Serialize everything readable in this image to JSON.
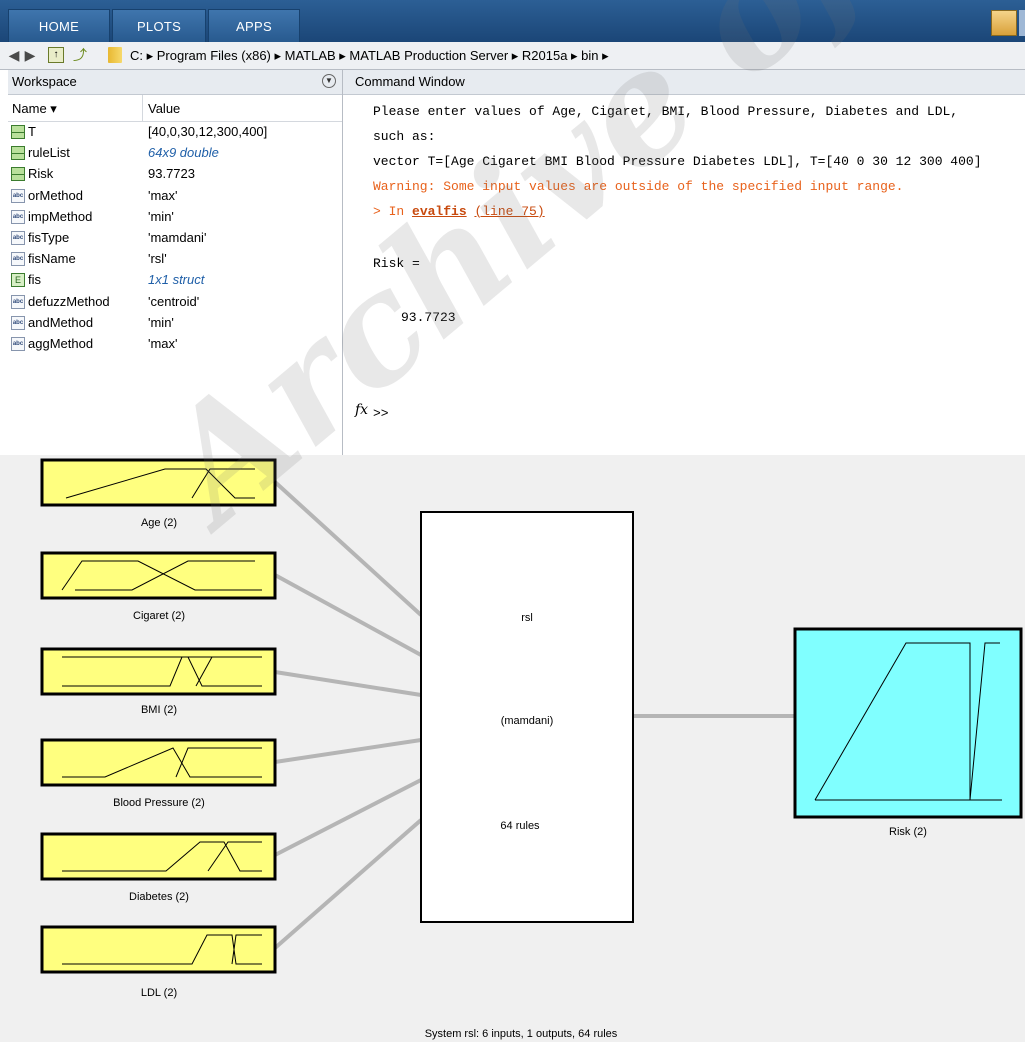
{
  "toolstrip": {
    "tabs": [
      "HOME",
      "PLOTS",
      "APPS"
    ]
  },
  "address": {
    "path": "C: ▸ Program Files (x86) ▸ MATLAB ▸ MATLAB Production Server ▸ R2015a ▸ bin ▸"
  },
  "workspace": {
    "title": "Workspace",
    "col_name": "Name ▾",
    "col_value": "Value",
    "rows": [
      {
        "name": "T",
        "value": "[40,0,30,12,300,400]",
        "icon": "matrix-icon"
      },
      {
        "name": "ruleList",
        "value": "64x9 double",
        "icon": "matrix-icon"
      },
      {
        "name": "Risk",
        "value": "93.7723",
        "icon": "matrix-icon"
      },
      {
        "name": "orMethod",
        "value": "'max'",
        "icon": "char-icon"
      },
      {
        "name": "impMethod",
        "value": "'min'",
        "icon": "char-icon"
      },
      {
        "name": "fisType",
        "value": "'mamdani'",
        "icon": "char-icon"
      },
      {
        "name": "fisName",
        "value": "'rsl'",
        "icon": "char-icon"
      },
      {
        "name": "fis",
        "value": "1x1 struct",
        "icon": "struct-icon"
      },
      {
        "name": "defuzzMethod",
        "value": "'centroid'",
        "icon": "char-icon"
      },
      {
        "name": "andMethod",
        "value": "'min'",
        "icon": "char-icon"
      },
      {
        "name": "aggMethod",
        "value": "'max'",
        "icon": "char-icon"
      }
    ]
  },
  "command_window": {
    "title": "Command Window",
    "line1": "Please enter values of Age, Cigaret, BMI, Blood Pressure, Diabetes and LDL,",
    "line2": "such as:",
    "line3": "vector T=[Age Cigaret BMI Blood Pressure Diabetes LDL], T=[40 0 30 12 300 400]",
    "warning": "Warning: Some input values are outside of the specified input range.",
    "trace_prefix": "> In ",
    "trace_func": "evalfis",
    "trace_line": "(line 75)",
    "result_label": "Risk =",
    "result_value": "93.7723",
    "fx": "fx",
    "prompt": ">>"
  },
  "fis": {
    "inputs": [
      "Age (2)",
      "Cigaret (2)",
      "BMI (2)",
      "Blood Pressure (2)",
      "Diabetes (2)",
      "LDL (2)"
    ],
    "output": "Risk (2)",
    "system_name": "rsl",
    "system_type": "(mamdani)",
    "system_rules": "64 rules",
    "status": "System rsl: 6 inputs, 1 outputs, 64 rules",
    "input_color": "#ffff7f",
    "output_color": "#80ffff"
  },
  "watermark": "Archive of SID"
}
